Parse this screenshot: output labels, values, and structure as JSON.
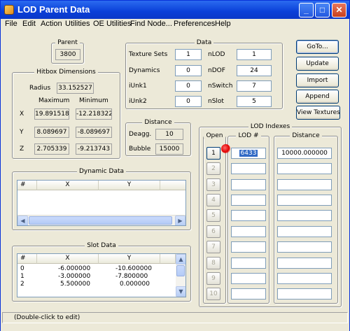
{
  "window": {
    "title": "LOD Parent Data"
  },
  "menu": [
    "File",
    "Edit",
    "Action",
    "Utilities",
    "OE Utilities",
    "Find Node...",
    "Preferences",
    "Help"
  ],
  "parent": {
    "title": "Parent",
    "value": "3800"
  },
  "hitbox": {
    "title": "Hitbox Dimensions",
    "radius_label": "Radius",
    "radius": "33.152527",
    "max_header": "Maximum",
    "min_header": "Minimum",
    "rows": [
      {
        "axis": "X",
        "max": "19.891518",
        "min": "-12.218322"
      },
      {
        "axis": "Y",
        "max": "8.089697",
        "min": "-8.089697"
      },
      {
        "axis": "Z",
        "max": "2.705339",
        "min": "-9.213743"
      }
    ]
  },
  "data": {
    "title": "Data",
    "left": [
      {
        "label": "Texture Sets",
        "value": "1"
      },
      {
        "label": "Dynamics",
        "value": "0"
      },
      {
        "label": "iUnk1",
        "value": "0"
      },
      {
        "label": "iUnk2",
        "value": "0"
      }
    ],
    "right": [
      {
        "label": "nLOD",
        "value": "1"
      },
      {
        "label": "nDOF",
        "value": "24"
      },
      {
        "label": "nSwitch",
        "value": "7"
      },
      {
        "label": "nSlot",
        "value": "5"
      }
    ]
  },
  "distance": {
    "title": "Distance",
    "deagg_label": "Deagg.",
    "deagg": "10",
    "bubble_label": "Bubble",
    "bubble": "15000"
  },
  "buttons": {
    "goto": "GoTo...",
    "update": "Update",
    "import": "Import",
    "append": "Append",
    "view_textures": "View Textures"
  },
  "dynamic_data": {
    "title": "Dynamic Data",
    "columns": [
      "#",
      "X",
      "Y"
    ]
  },
  "slot_data": {
    "title": "Slot Data",
    "columns": [
      "#",
      "X",
      "Y"
    ],
    "rows": [
      {
        "n": "0",
        "x": "-6.000000",
        "y": "-10.600000"
      },
      {
        "n": "1",
        "x": "-3.000000",
        "y": "-7.800000"
      },
      {
        "n": "2",
        "x": "5.500000",
        "y": "0.000000"
      }
    ]
  },
  "lod_indexes": {
    "title": "LOD Indexes",
    "col_open": "Open",
    "col_lod": "LOD #",
    "col_distance": "Distance",
    "rows": [
      {
        "n": "1",
        "lod": "6433",
        "distance": "10000.000000"
      },
      {
        "n": "2",
        "lod": "",
        "distance": ""
      },
      {
        "n": "3",
        "lod": "",
        "distance": ""
      },
      {
        "n": "4",
        "lod": "",
        "distance": ""
      },
      {
        "n": "5",
        "lod": "",
        "distance": ""
      },
      {
        "n": "6",
        "lod": "",
        "distance": ""
      },
      {
        "n": "7",
        "lod": "",
        "distance": ""
      },
      {
        "n": "8",
        "lod": "",
        "distance": ""
      },
      {
        "n": "9",
        "lod": "",
        "distance": ""
      },
      {
        "n": "10",
        "lod": "",
        "distance": ""
      }
    ]
  },
  "status": "(Double-click to edit)"
}
